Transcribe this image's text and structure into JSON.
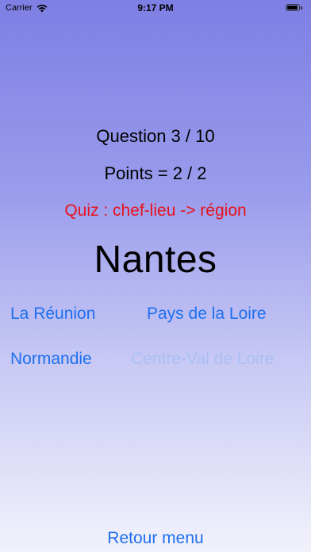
{
  "status_bar": {
    "carrier": "Carrier",
    "time": "9:17 PM",
    "battery_level": 0.95
  },
  "quiz": {
    "question_label": "Question 3 / 10",
    "points_label": "Points = 2 / 2",
    "quiz_type": "Quiz : chef-lieu -> région",
    "city": "Nantes",
    "answers": [
      {
        "label": "La Réunion",
        "enabled": true
      },
      {
        "label": "Pays de la Loire",
        "enabled": true
      },
      {
        "label": "Normandie",
        "enabled": true
      },
      {
        "label": "Centre-Val de Loire",
        "enabled": false
      }
    ],
    "back_label": "Retour menu"
  },
  "colors": {
    "accent": "#1e6ff0",
    "quiz_type_red": "#e8121c",
    "disabled": "#a9c0f5"
  }
}
